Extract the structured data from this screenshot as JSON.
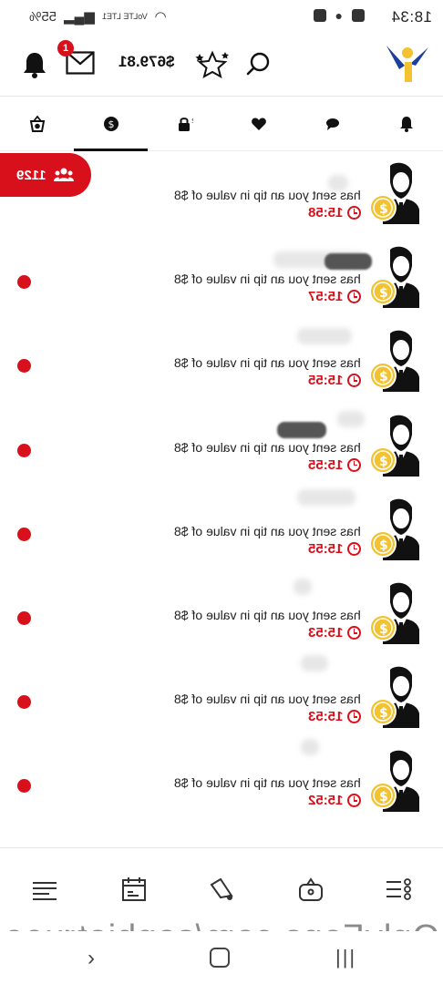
{
  "status_bar": {
    "time": "18:34",
    "battery": "55%",
    "network": "VoLTE LTE1"
  },
  "header": {
    "notification_count": "1",
    "balance": "$679.81"
  },
  "tabs": [
    {
      "icon": "bell-icon"
    },
    {
      "icon": "chat-icon"
    },
    {
      "icon": "heart-icon"
    },
    {
      "icon": "lock-dollar-icon"
    },
    {
      "icon": "dollar-circle-icon",
      "active": true
    },
    {
      "icon": "basket-dollar-icon"
    }
  ],
  "online": {
    "count": "1129"
  },
  "notifications": [
    {
      "message": "has sent you an tip in value of $8",
      "time": "15:58",
      "unread": false
    },
    {
      "message": "has sent you an tip in value of $8",
      "time": "15:57",
      "unread": true
    },
    {
      "message": "has sent you an tip in value of $8",
      "time": "15:55",
      "unread": true
    },
    {
      "message": "has sent you an tip in value of $8",
      "time": "15:55",
      "unread": true
    },
    {
      "message": "has sent you an tip in value of $8",
      "time": "15:55",
      "unread": true
    },
    {
      "message": "has sent you an tip in value of $8",
      "time": "15:53",
      "unread": true
    },
    {
      "message": "has sent you an tip in value of $8",
      "time": "15:53",
      "unread": true
    },
    {
      "message": "has sent you an tip in value of $8",
      "time": "15:52",
      "unread": true
    }
  ],
  "bottom_nav": [
    {
      "icon": "menu-lines-icon"
    },
    {
      "icon": "calendar-icon"
    },
    {
      "icon": "megaphone-icon"
    },
    {
      "icon": "bag-icon"
    },
    {
      "icon": "list-dots-icon"
    }
  ],
  "watermark": "OnlyFans.com/sophiatruee",
  "colors": {
    "accent": "#d8101b",
    "text": "#222222",
    "coin": "#f2c230"
  }
}
